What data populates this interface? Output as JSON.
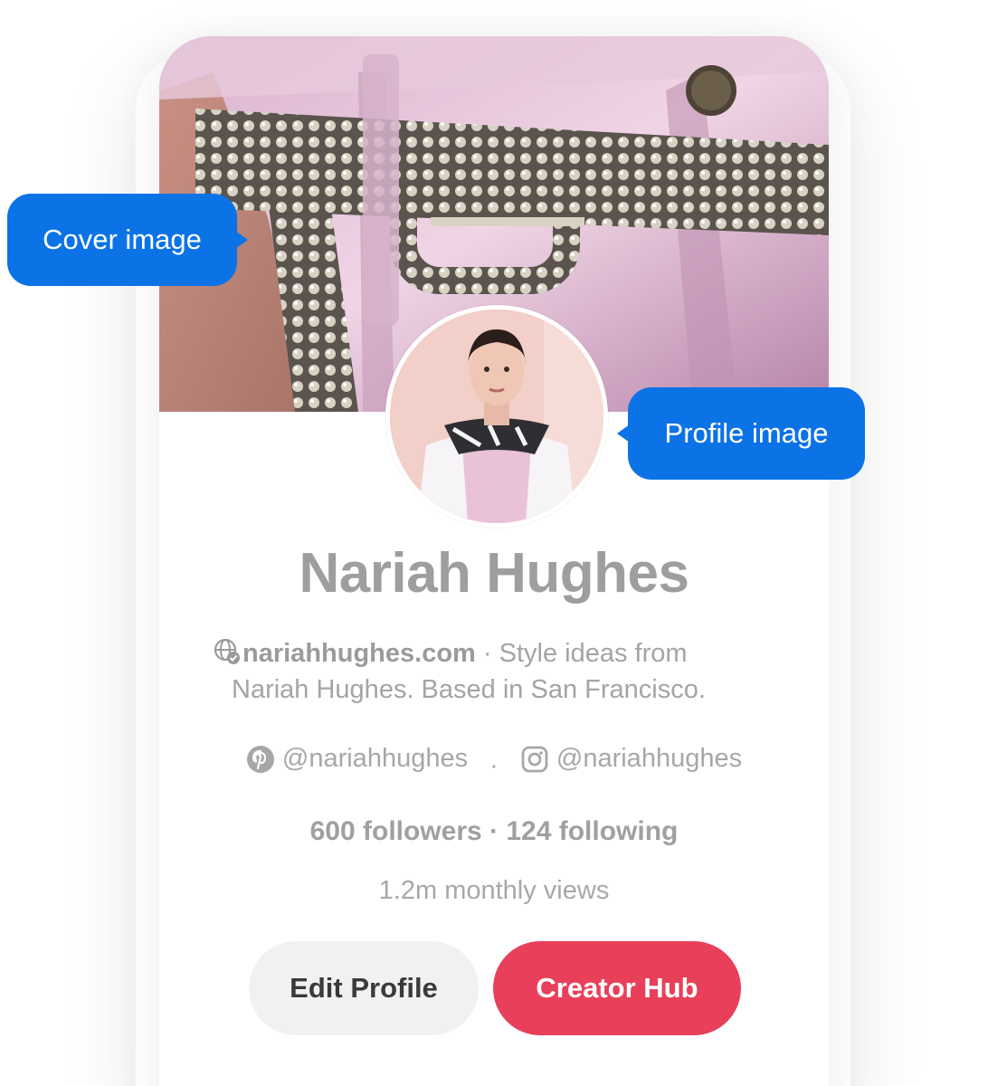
{
  "profile": {
    "name": "Nariah Hughes",
    "website": "nariahhughes.com",
    "bio_line1": " · Style ideas from",
    "bio_line2": "Nariah Hughes. Based in San Francisco.",
    "pinterest_handle": "@nariahhughes",
    "instagram_handle": "@nariahhughes",
    "social_separator": "·",
    "stats": "600 followers · 124 following",
    "monthly_views": "1.2m monthly views"
  },
  "actions": {
    "edit_label": "Edit Profile",
    "hub_label": "Creator Hub"
  },
  "callouts": {
    "cover": "Cover image",
    "profile": "Profile image"
  },
  "icons": {
    "website": "globe-verified-icon",
    "pinterest": "pinterest-icon",
    "instagram": "instagram-icon"
  },
  "colors": {
    "accent": "#e8405a",
    "callout": "#0c73e6",
    "button_secondary": "#f1f1f1",
    "text_muted": "#a4a4a4"
  }
}
